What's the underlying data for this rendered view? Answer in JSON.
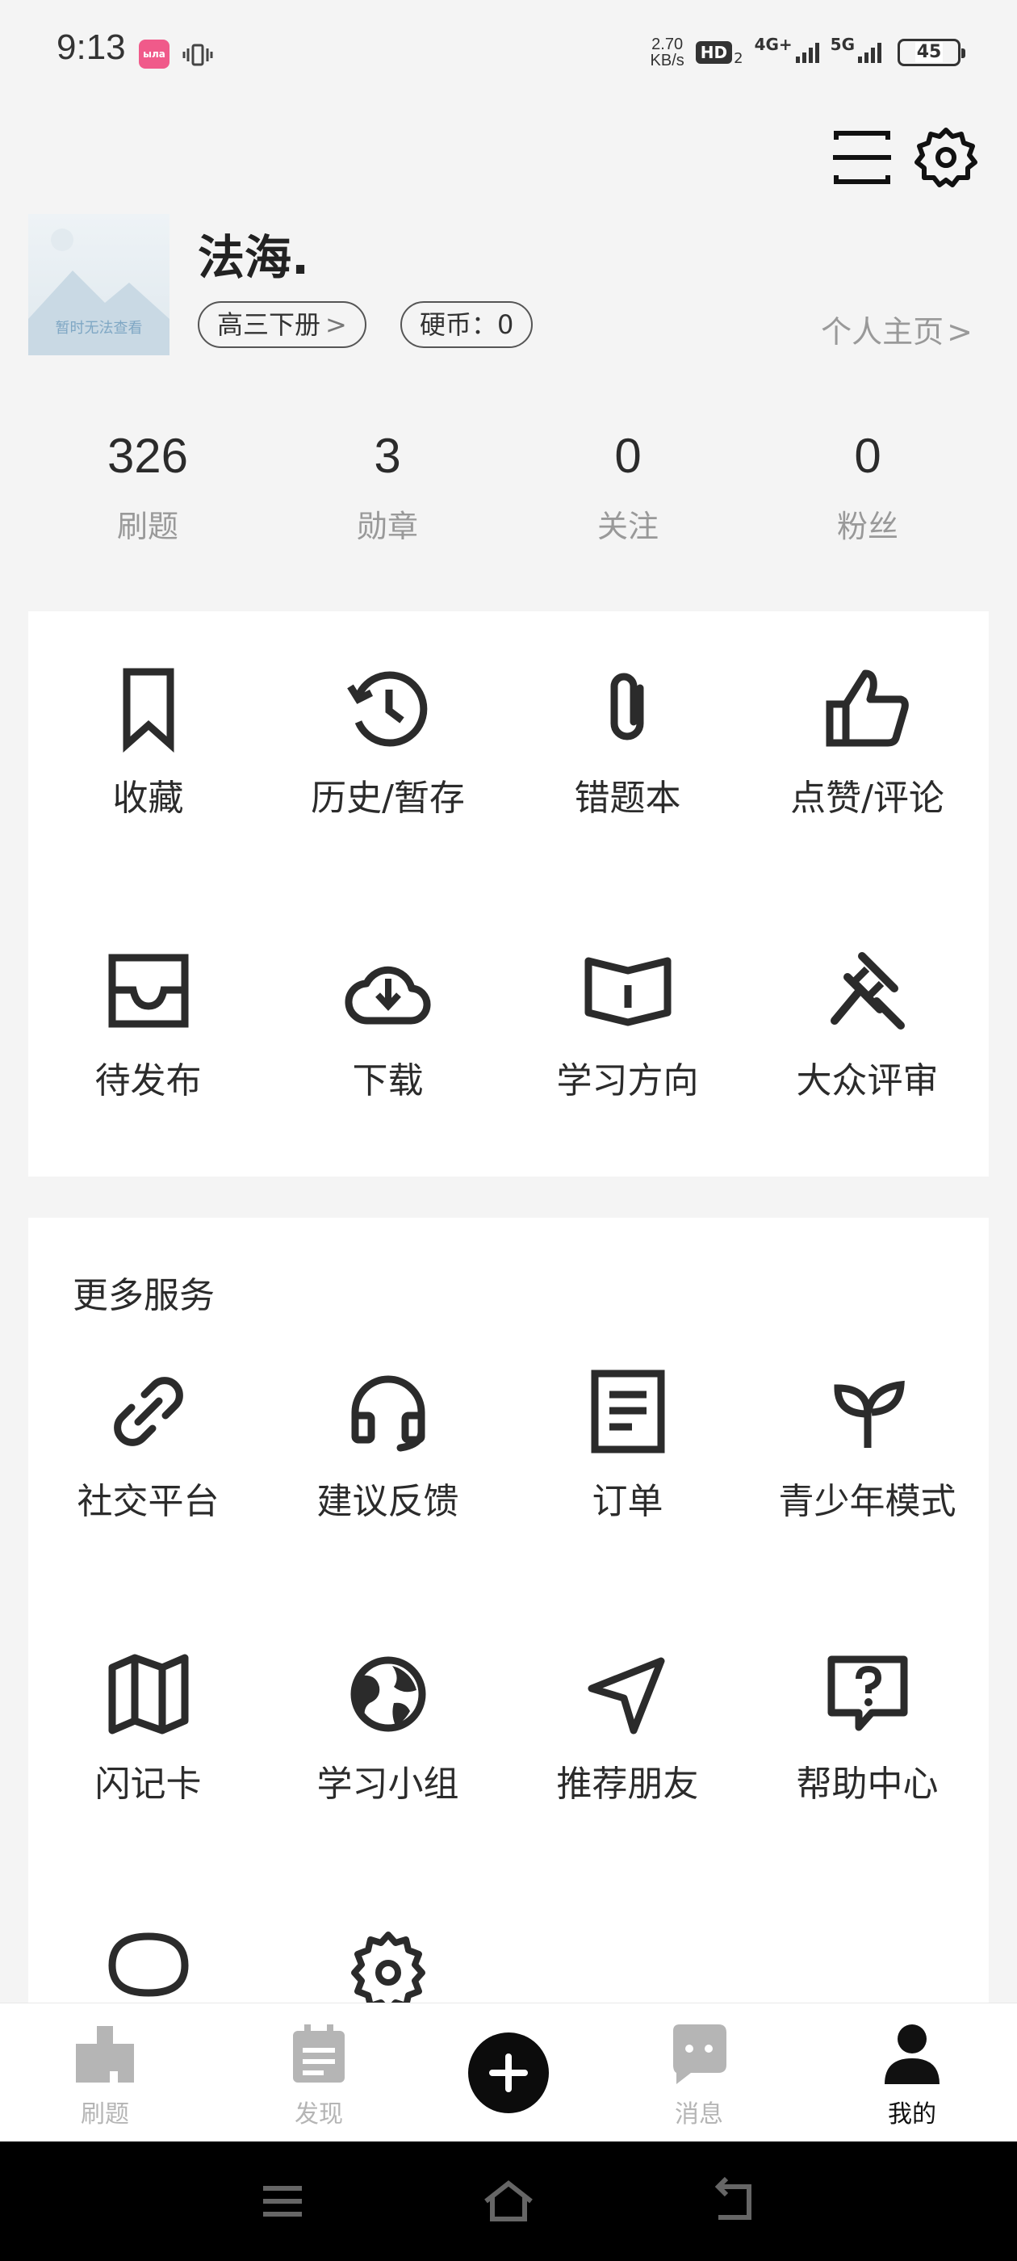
{
  "status_bar": {
    "time": "9:13",
    "app_badge": "ыла",
    "speed_value": "2.70",
    "speed_unit": "KB/s",
    "hd": "HD",
    "hd_sub": "2",
    "net1": "4G+",
    "net2": "5G",
    "battery": "45"
  },
  "profile": {
    "avatar_caption": "暂时无法查看",
    "name": "法海.",
    "grade_chip": "高三下册",
    "coin_chip": "硬币：0",
    "homepage_link": "个人主页"
  },
  "stats": [
    {
      "value": "326",
      "label": "刷题"
    },
    {
      "value": "3",
      "label": "勋章"
    },
    {
      "value": "0",
      "label": "关注"
    },
    {
      "value": "0",
      "label": "粉丝"
    }
  ],
  "quick_menu": [
    {
      "label": "收藏",
      "icon": "bookmark-icon"
    },
    {
      "label": "历史/暂存",
      "icon": "history-icon"
    },
    {
      "label": "错题本",
      "icon": "paperclip-icon"
    },
    {
      "label": "点赞/评论",
      "icon": "thumbs-up-icon"
    },
    {
      "label": "待发布",
      "icon": "inbox-icon"
    },
    {
      "label": "下载",
      "icon": "cloud-download-icon"
    },
    {
      "label": "学习方向",
      "icon": "open-book-icon"
    },
    {
      "label": "大众评审",
      "icon": "gavel-icon"
    }
  ],
  "more_services": {
    "title": "更多服务",
    "items": [
      {
        "label": "社交平台",
        "icon": "link-icon"
      },
      {
        "label": "建议反馈",
        "icon": "headset-icon"
      },
      {
        "label": "订单",
        "icon": "document-icon"
      },
      {
        "label": "青少年模式",
        "icon": "sprout-icon"
      },
      {
        "label": "闪记卡",
        "icon": "map-icon"
      },
      {
        "label": "学习小组",
        "icon": "globe-icon"
      },
      {
        "label": "推荐朋友",
        "icon": "send-icon"
      },
      {
        "label": "帮助中心",
        "icon": "help-chat-icon"
      }
    ]
  },
  "tabbar": [
    {
      "label": "刷题",
      "icon": "brush-icon"
    },
    {
      "label": "发现",
      "icon": "calendar-icon"
    },
    {
      "label": "消息",
      "icon": "message-icon"
    },
    {
      "label": "我的",
      "icon": "person-icon",
      "active": true
    }
  ],
  "colors": {
    "background": "#f4f4f4",
    "card": "#ffffff",
    "text": "#2b2b2b",
    "muted": "#999999",
    "tab_inactive": "#b5b5b5",
    "tab_active": "#111111"
  }
}
